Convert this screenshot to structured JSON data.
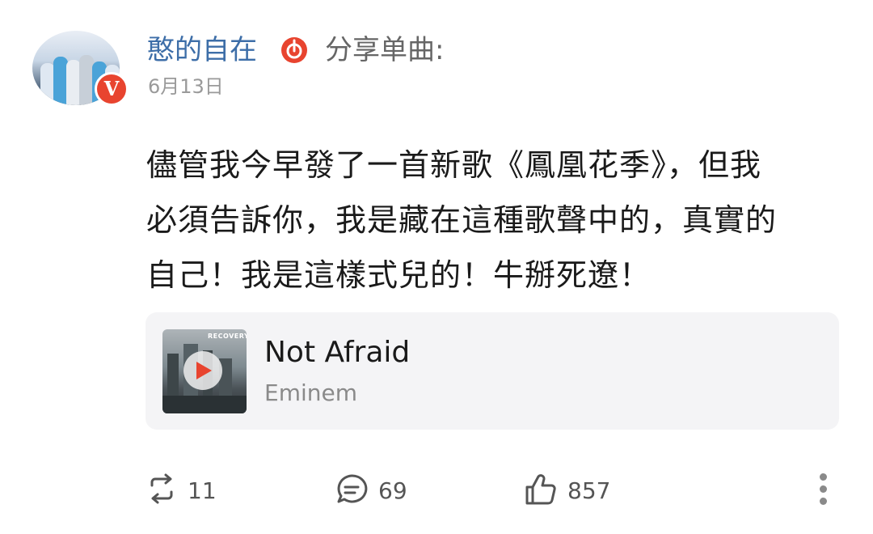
{
  "post": {
    "username": "憨的自在",
    "share_label": "分享单曲:",
    "date": "6月13日",
    "verified_badge": "V",
    "text_lines": [
      "儘管我今早發了一首新歌《鳳凰花季》，但我",
      "必須告訴你，我是藏在這種歌聲中的，真實的",
      "自己！我是這樣式兒的！牛掰死遼！"
    ]
  },
  "music": {
    "title": "Not Afraid",
    "artist": "Eminem",
    "cover_text": "RECOVERY",
    "icon": "music-note-icon",
    "accent": "#e8442f"
  },
  "actions": {
    "repost_count": "11",
    "comment_count": "69",
    "like_count": "857"
  },
  "colors": {
    "username": "#3d6ea8",
    "badge": "#e8442f",
    "card_bg": "#f4f4f6"
  }
}
